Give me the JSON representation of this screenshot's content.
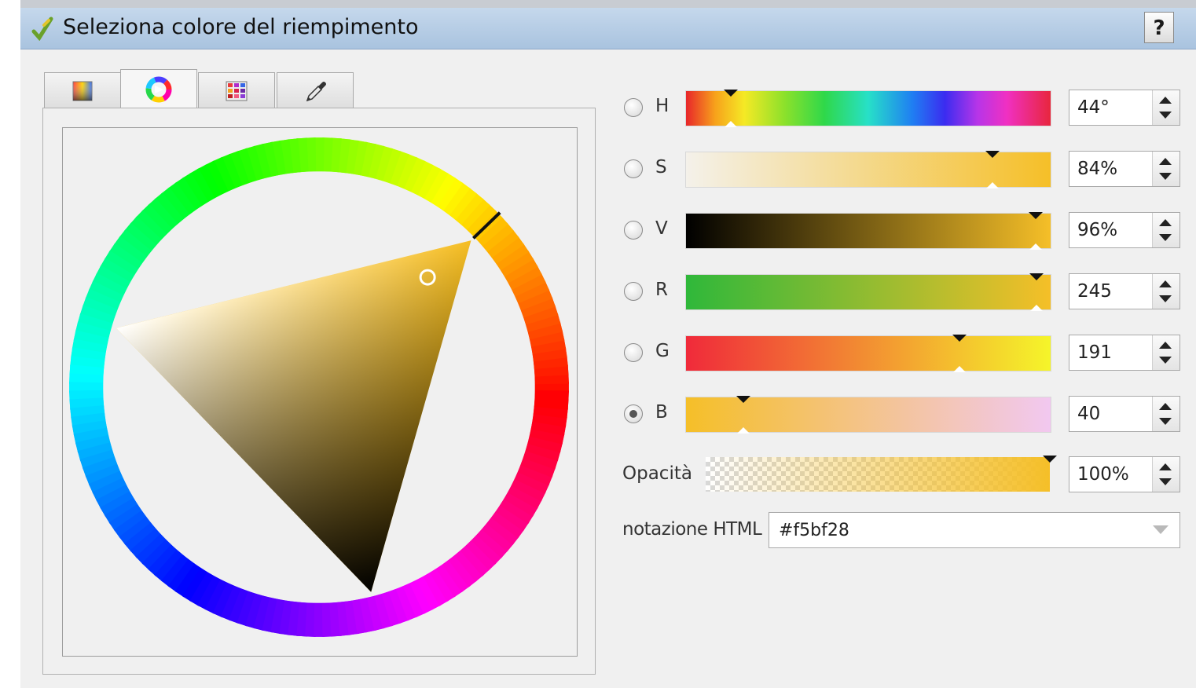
{
  "window": {
    "title": "Seleziona colore del riempimento",
    "help_label": "?"
  },
  "tabs": [
    {
      "icon": "color-ramp-icon",
      "active": false
    },
    {
      "icon": "color-wheel-icon",
      "active": true
    },
    {
      "icon": "color-swatches-icon",
      "active": false
    },
    {
      "icon": "eyedropper-icon",
      "active": false
    }
  ],
  "wheel": {
    "hue_deg": 44,
    "selected_color": "#f5bf28"
  },
  "channels": [
    {
      "key": "h",
      "label": "H",
      "value": "44°",
      "fraction": 0.122,
      "checked": false
    },
    {
      "key": "s",
      "label": "S",
      "value": "84%",
      "fraction": 0.84,
      "checked": false
    },
    {
      "key": "v",
      "label": "V",
      "value": "96%",
      "fraction": 0.96,
      "checked": false
    },
    {
      "key": "r",
      "label": "R",
      "value": "245",
      "fraction": 0.961,
      "checked": false
    },
    {
      "key": "g",
      "label": "G",
      "value": "191",
      "fraction": 0.749,
      "checked": false
    },
    {
      "key": "b",
      "label": "B",
      "value": "40",
      "fraction": 0.157,
      "checked": true
    }
  ],
  "opacity": {
    "label": "Opacità",
    "value": "100%",
    "fraction": 1.0
  },
  "html_notation": {
    "label": "notazione HTML",
    "value": "#f5bf28"
  }
}
